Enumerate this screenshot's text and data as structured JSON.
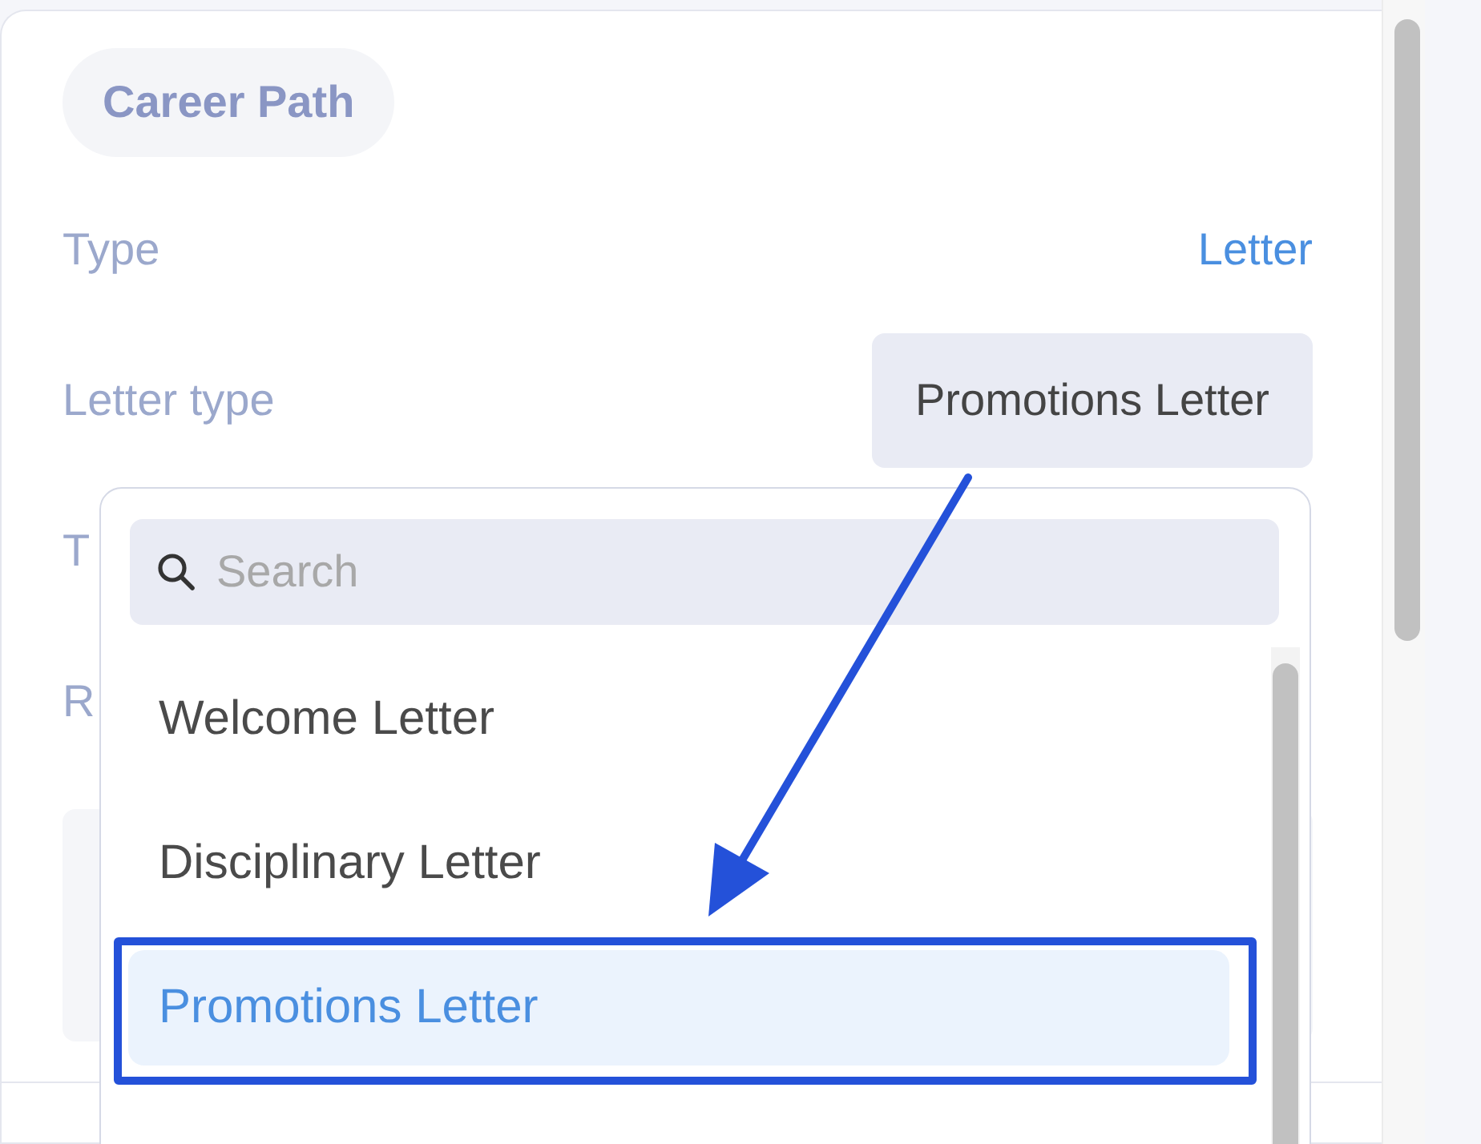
{
  "panel": {
    "chip": "Career Path",
    "fields": [
      {
        "label": "Type",
        "kind": "text",
        "value": "Letter"
      },
      {
        "label": "Letter type",
        "kind": "select",
        "value": "Promotions Letter"
      },
      {
        "label": "T",
        "kind": "covered"
      },
      {
        "label": "R",
        "kind": "covered"
      }
    ]
  },
  "dropdown": {
    "search": {
      "placeholder": "Search"
    },
    "options": [
      {
        "label": "Welcome Letter",
        "selected": false
      },
      {
        "label": "Disciplinary Letter",
        "selected": false
      },
      {
        "label": "Promotions Letter",
        "selected": true
      }
    ]
  }
}
